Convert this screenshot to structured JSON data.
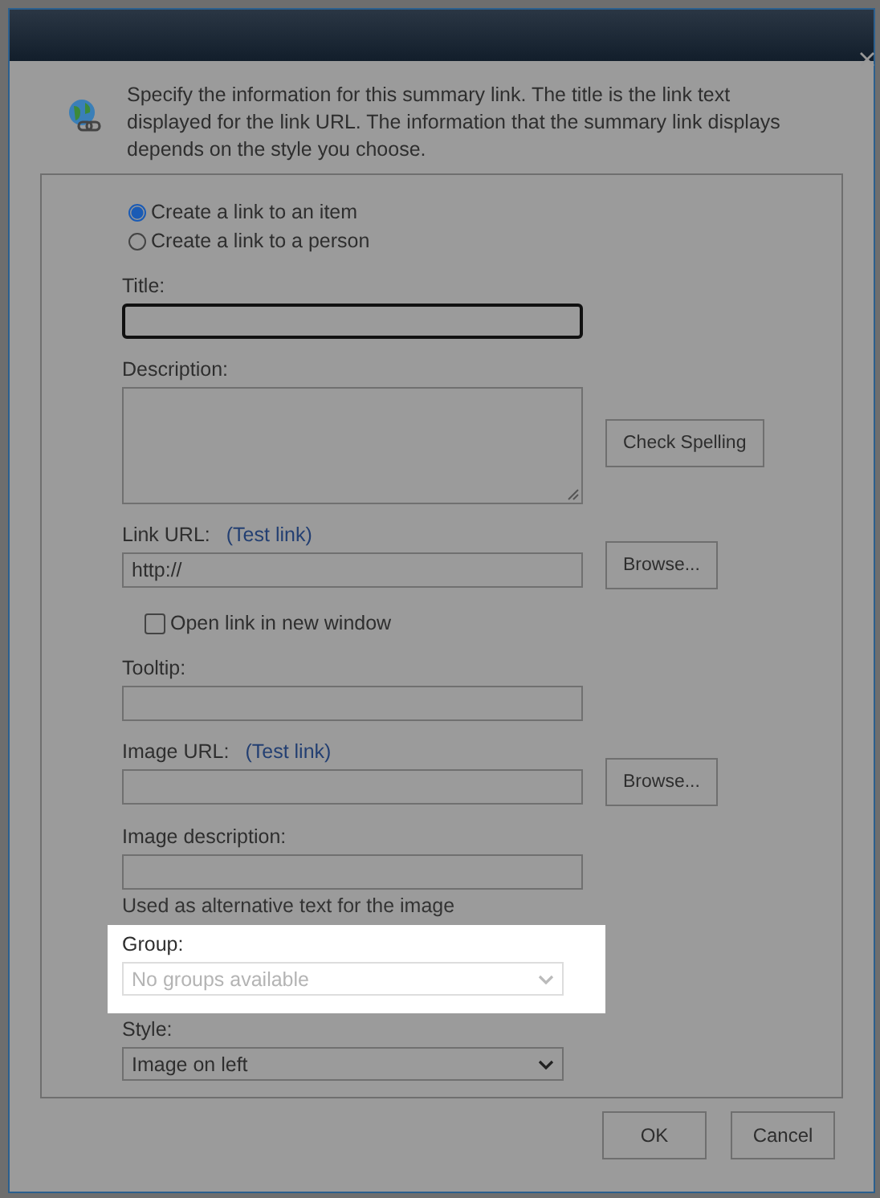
{
  "dialog": {
    "intro": "Specify the information for this summary link. The title is the link text displayed for the link URL. The information that the summary link displays depends on the style you choose.",
    "link_type": [
      {
        "label": "Create a link to an item",
        "selected": true
      },
      {
        "label": "Create a link to a person",
        "selected": false
      }
    ],
    "fields": [
      {
        "kind": "text",
        "label": "Title:",
        "focused": true
      },
      {
        "kind": "textarea",
        "label": "Description:",
        "button": "Check Spelling"
      },
      {
        "kind": "text",
        "label": "Link URL:",
        "link": "(Test link)",
        "value": "http://",
        "button": "Browse..."
      },
      {
        "kind": "checkbox",
        "label": "Open link in new window",
        "checked": false
      },
      {
        "kind": "text",
        "label": "Tooltip:"
      },
      {
        "kind": "text",
        "label": "Image URL:",
        "link": "(Test link)",
        "button": "Browse..."
      },
      {
        "kind": "text",
        "label": "Image description:",
        "hint": "Used as alternative text for the image"
      },
      {
        "kind": "select",
        "label": "Group:",
        "value": "No groups available",
        "disabled": true,
        "highlighted": true
      },
      {
        "kind": "select",
        "label": "Style:",
        "value": "Image on left",
        "disabled": false
      }
    ],
    "buttons": [
      "OK",
      "Cancel"
    ]
  }
}
